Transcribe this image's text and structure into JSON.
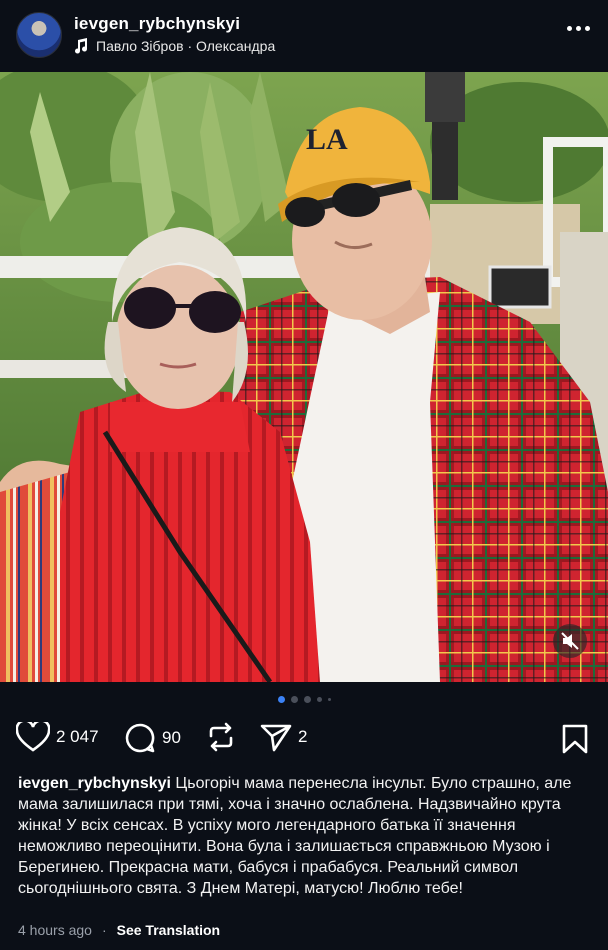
{
  "header": {
    "username": "ievgen_rybchynskyi",
    "music_icon": "music-note-icon",
    "music_text": "Павло Зібров · Олександра",
    "more_icon": "more-horizontal-icon"
  },
  "media": {
    "mute_icon": "speaker-muted-icon",
    "carousel_total": 5,
    "carousel_index": 1
  },
  "actions": {
    "likes": "2 047",
    "comments": "90",
    "shares": "2"
  },
  "caption": {
    "author": "ievgen_rybchynskyi",
    "text": " Цьогоріч мама перенесла інсульт. Було страшно, але мама залишилася при тямі, хоча і значно ослаблена. Надзвичайно крута жінка! У всіх сенсах. В успіху мого легендарного батька її значення неможливо переоцінити. Вона була і залишається справжньою Музою і Берегинею. Прекрасна мати, бабуся і прабабуся. Реальний символ сьогоднішнього свята. З Днем Матері, матусю! Люблю тебе!"
  },
  "meta": {
    "time": "4 hours ago",
    "dot": "·",
    "translate": "See Translation"
  },
  "colors": {
    "background": "#0b0f17",
    "accent": "#3b82f6",
    "plaid_red": "#d4262e",
    "cap_yellow": "#f0b43c"
  }
}
